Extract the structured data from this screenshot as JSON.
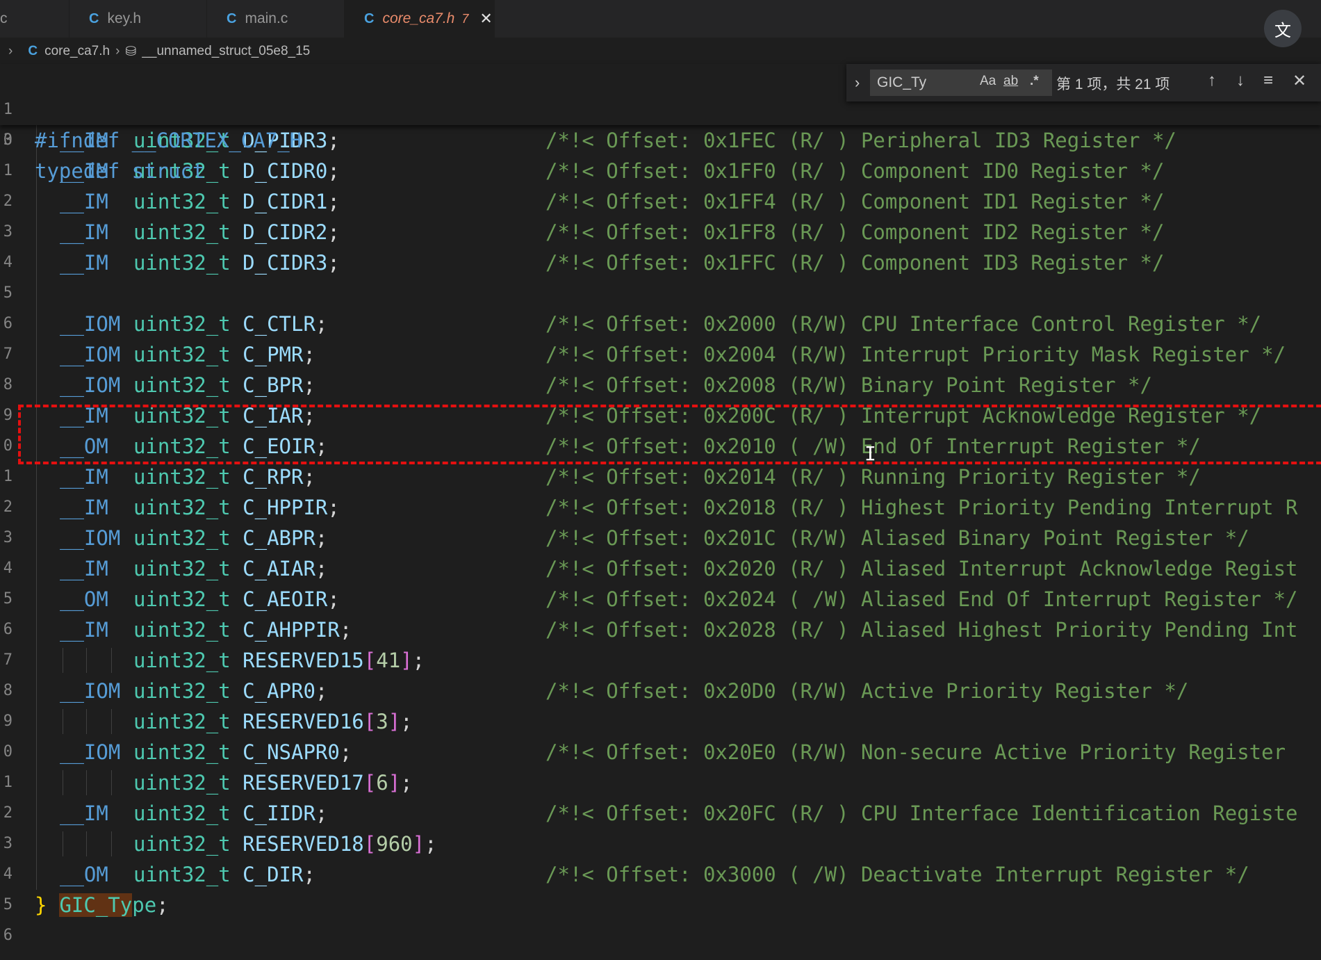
{
  "tabs": [
    {
      "name": "c",
      "label": "c",
      "icon": ""
    },
    {
      "name": "key-h",
      "label": "key.h",
      "icon": "C"
    },
    {
      "name": "main-c",
      "label": "main.c",
      "icon": "C"
    },
    {
      "name": "core-ca7-h",
      "label": "core_ca7.h",
      "icon": "C",
      "badge": "7",
      "close": "✕"
    }
  ],
  "translate_icon": "文",
  "breadcrumb": {
    "first_sep": "›",
    "file_icon": "C",
    "file": "core_ca7.h",
    "sep": "›",
    "struct_icon": "⛁",
    "symbol": "__unnamed_struct_05e8_15"
  },
  "sticky": [
    {
      "ln": "1",
      "code": "#ifndef __CORTEX_CA7_H"
    },
    {
      "ln": "3",
      "code": "typedef struct"
    }
  ],
  "find": {
    "toggle": "›",
    "value": "GIC_Ty",
    "match_case": "Aa",
    "whole_word": "ab",
    "regex": ".*",
    "count": "第 1 项，共 21 项",
    "prev": "↑",
    "next": "↓",
    "selection": "≡",
    "close": "✕"
  },
  "lines": [
    {
      "ln": "0",
      "qual": "__IM ",
      "type": "uint32_t",
      "field": "D_PIDR3",
      "arr": "",
      "comment": "/*!< Offset: 0x1FEC (R/ ) Peripheral ID3 Register */"
    },
    {
      "ln": "1",
      "qual": "__IM ",
      "type": "uint32_t",
      "field": "D_CIDR0",
      "arr": "",
      "comment": "/*!< Offset: 0x1FF0 (R/ ) Component ID0 Register */"
    },
    {
      "ln": "2",
      "qual": "__IM ",
      "type": "uint32_t",
      "field": "D_CIDR1",
      "arr": "",
      "comment": "/*!< Offset: 0x1FF4 (R/ ) Component ID1 Register */"
    },
    {
      "ln": "3",
      "qual": "__IM ",
      "type": "uint32_t",
      "field": "D_CIDR2",
      "arr": "",
      "comment": "/*!< Offset: 0x1FF8 (R/ ) Component ID2 Register */"
    },
    {
      "ln": "4",
      "qual": "__IM ",
      "type": "uint32_t",
      "field": "D_CIDR3",
      "arr": "",
      "comment": "/*!< Offset: 0x1FFC (R/ ) Component ID3 Register */"
    },
    {
      "ln": "5",
      "qual": "",
      "type": "",
      "field": "",
      "arr": "",
      "comment": ""
    },
    {
      "ln": "6",
      "qual": "__IOM",
      "type": "uint32_t",
      "field": "C_CTLR",
      "arr": "",
      "comment": "/*!< Offset: 0x2000 (R/W) CPU Interface Control Register */"
    },
    {
      "ln": "7",
      "qual": "__IOM",
      "type": "uint32_t",
      "field": "C_PMR",
      "arr": "",
      "comment": "/*!< Offset: 0x2004 (R/W) Interrupt Priority Mask Register */"
    },
    {
      "ln": "8",
      "qual": "__IOM",
      "type": "uint32_t",
      "field": "C_BPR",
      "arr": "",
      "comment": "/*!< Offset: 0x2008 (R/W) Binary Point Register */"
    },
    {
      "ln": "9",
      "qual": "__IM ",
      "type": "uint32_t",
      "field": "C_IAR",
      "arr": "",
      "comment": "/*!< Offset: 0x200C (R/ ) Interrupt Acknowledge Register */"
    },
    {
      "ln": "0",
      "qual": "__OM ",
      "type": "uint32_t",
      "field": "C_EOIR",
      "arr": "",
      "comment": "/*!< Offset: 0x2010 ( /W) End Of Interrupt Register */"
    },
    {
      "ln": "1",
      "qual": "__IM ",
      "type": "uint32_t",
      "field": "C_RPR",
      "arr": "",
      "comment": "/*!< Offset: 0x2014 (R/ ) Running Priority Register */"
    },
    {
      "ln": "2",
      "qual": "__IM ",
      "type": "uint32_t",
      "field": "C_HPPIR",
      "arr": "",
      "comment": "/*!< Offset: 0x2018 (R/ ) Highest Priority Pending Interrupt R"
    },
    {
      "ln": "3",
      "qual": "__IOM",
      "type": "uint32_t",
      "field": "C_ABPR",
      "arr": "",
      "comment": "/*!< Offset: 0x201C (R/W) Aliased Binary Point Register */"
    },
    {
      "ln": "4",
      "qual": "__IM ",
      "type": "uint32_t",
      "field": "C_AIAR",
      "arr": "",
      "comment": "/*!< Offset: 0x2020 (R/ ) Aliased Interrupt Acknowledge Regist"
    },
    {
      "ln": "5",
      "qual": "__OM ",
      "type": "uint32_t",
      "field": "C_AEOIR",
      "arr": "",
      "comment": "/*!< Offset: 0x2024 ( /W) Aliased End Of Interrupt Register */"
    },
    {
      "ln": "6",
      "qual": "__IM ",
      "type": "uint32_t",
      "field": "C_AHPPIR",
      "arr": "",
      "comment": "/*!< Offset: 0x2028 (R/ ) Aliased Highest Priority Pending Int"
    },
    {
      "ln": "7",
      "qual": "",
      "type": "uint32_t",
      "field": "RESERVED15",
      "arr": "41",
      "comment": ""
    },
    {
      "ln": "8",
      "qual": "__IOM",
      "type": "uint32_t",
      "field": "C_APR0",
      "arr": "",
      "comment": "/*!< Offset: 0x20D0 (R/W) Active Priority Register */"
    },
    {
      "ln": "9",
      "qual": "",
      "type": "uint32_t",
      "field": "RESERVED16",
      "arr": "3",
      "comment": ""
    },
    {
      "ln": "0",
      "qual": "__IOM",
      "type": "uint32_t",
      "field": "C_NSAPR0",
      "arr": "",
      "comment": "/*!< Offset: 0x20E0 (R/W) Non-secure Active Priority Register"
    },
    {
      "ln": "1",
      "qual": "",
      "type": "uint32_t",
      "field": "RESERVED17",
      "arr": "6",
      "comment": ""
    },
    {
      "ln": "2",
      "qual": "__IM ",
      "type": "uint32_t",
      "field": "C_IIDR",
      "arr": "",
      "comment": "/*!< Offset: 0x20FC (R/ ) CPU Interface Identification Registe"
    },
    {
      "ln": "3",
      "qual": "",
      "type": "uint32_t",
      "field": "RESERVED18",
      "arr": "960",
      "comment": ""
    },
    {
      "ln": "4",
      "qual": "__OM ",
      "type": "uint32_t",
      "field": "C_DIR",
      "arr": "",
      "comment": "/*!< Offset: 0x3000 ( /W) Deactivate Interrupt Register */"
    }
  ],
  "closing": {
    "ln": "5",
    "brace": "}",
    "name_hl": "GIC_Ty",
    "name_rest": "pe",
    "semi": ";"
  },
  "last_ln": "6",
  "cursor_glyph": "I"
}
